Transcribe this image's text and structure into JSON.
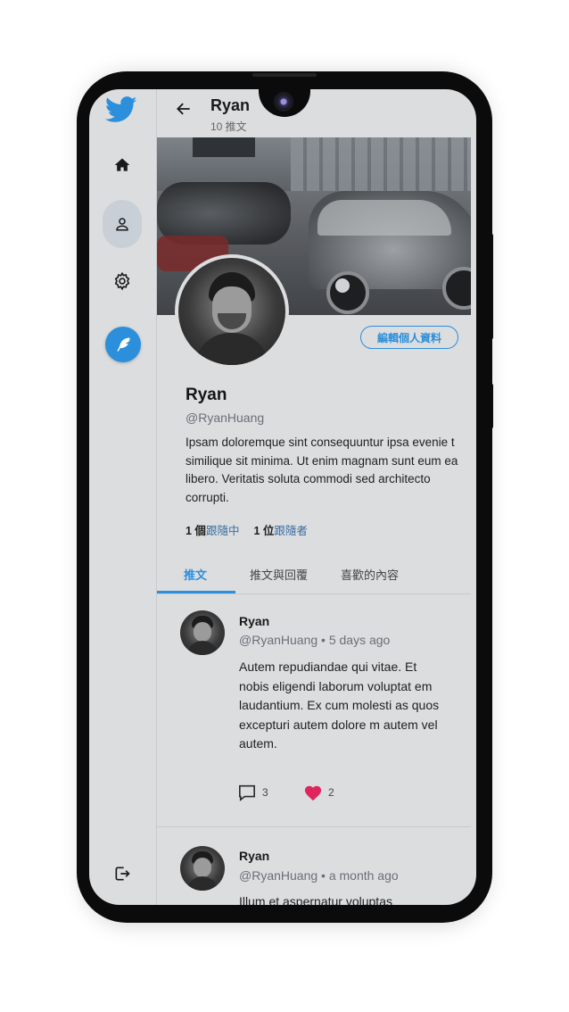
{
  "header": {
    "name": "Ryan",
    "tweet_count": "10 推文"
  },
  "sidebar": {
    "items": [
      {
        "name": "home",
        "icon": "home-icon"
      },
      {
        "name": "profile",
        "icon": "user-icon",
        "active": true
      },
      {
        "name": "settings",
        "icon": "gear-icon"
      },
      {
        "name": "compose",
        "icon": "feather-icon"
      },
      {
        "name": "logout",
        "icon": "logout-icon"
      }
    ]
  },
  "profile": {
    "edit_label": "編輯個人資料",
    "name": "Ryan",
    "handle": "@RyanHuang",
    "bio": "Ipsam doloremque sint consequuntur ipsa evenie t similique sit minima. Ut enim magnam sunt eum ea libero. Veritatis soluta commodi sed architecto corrupti.",
    "following_count": "1 個",
    "following_label": "跟隨中",
    "followers_count": "1 位",
    "followers_label": "跟隨者"
  },
  "tabs": [
    {
      "label": "推文",
      "active": true
    },
    {
      "label": "推文與回覆"
    },
    {
      "label": "喜歡的內容"
    }
  ],
  "tweets": [
    {
      "name": "Ryan",
      "meta": "@RyanHuang • 5 days ago",
      "body": "Autem repudiandae qui vitae. Et nobis eligendi laborum voluptat em laudantium. Ex cum molesti as quos excepturi autem dolore m autem vel autem.",
      "replies": "3",
      "likes": "2"
    },
    {
      "name": "Ryan",
      "meta": "@RyanHuang • a month ago",
      "body": "Illum et aspernatur voluptas"
    }
  ],
  "colors": {
    "accent": "#2b8fdb",
    "like": "#e0245e",
    "screen_bg": "#dcdddf"
  }
}
